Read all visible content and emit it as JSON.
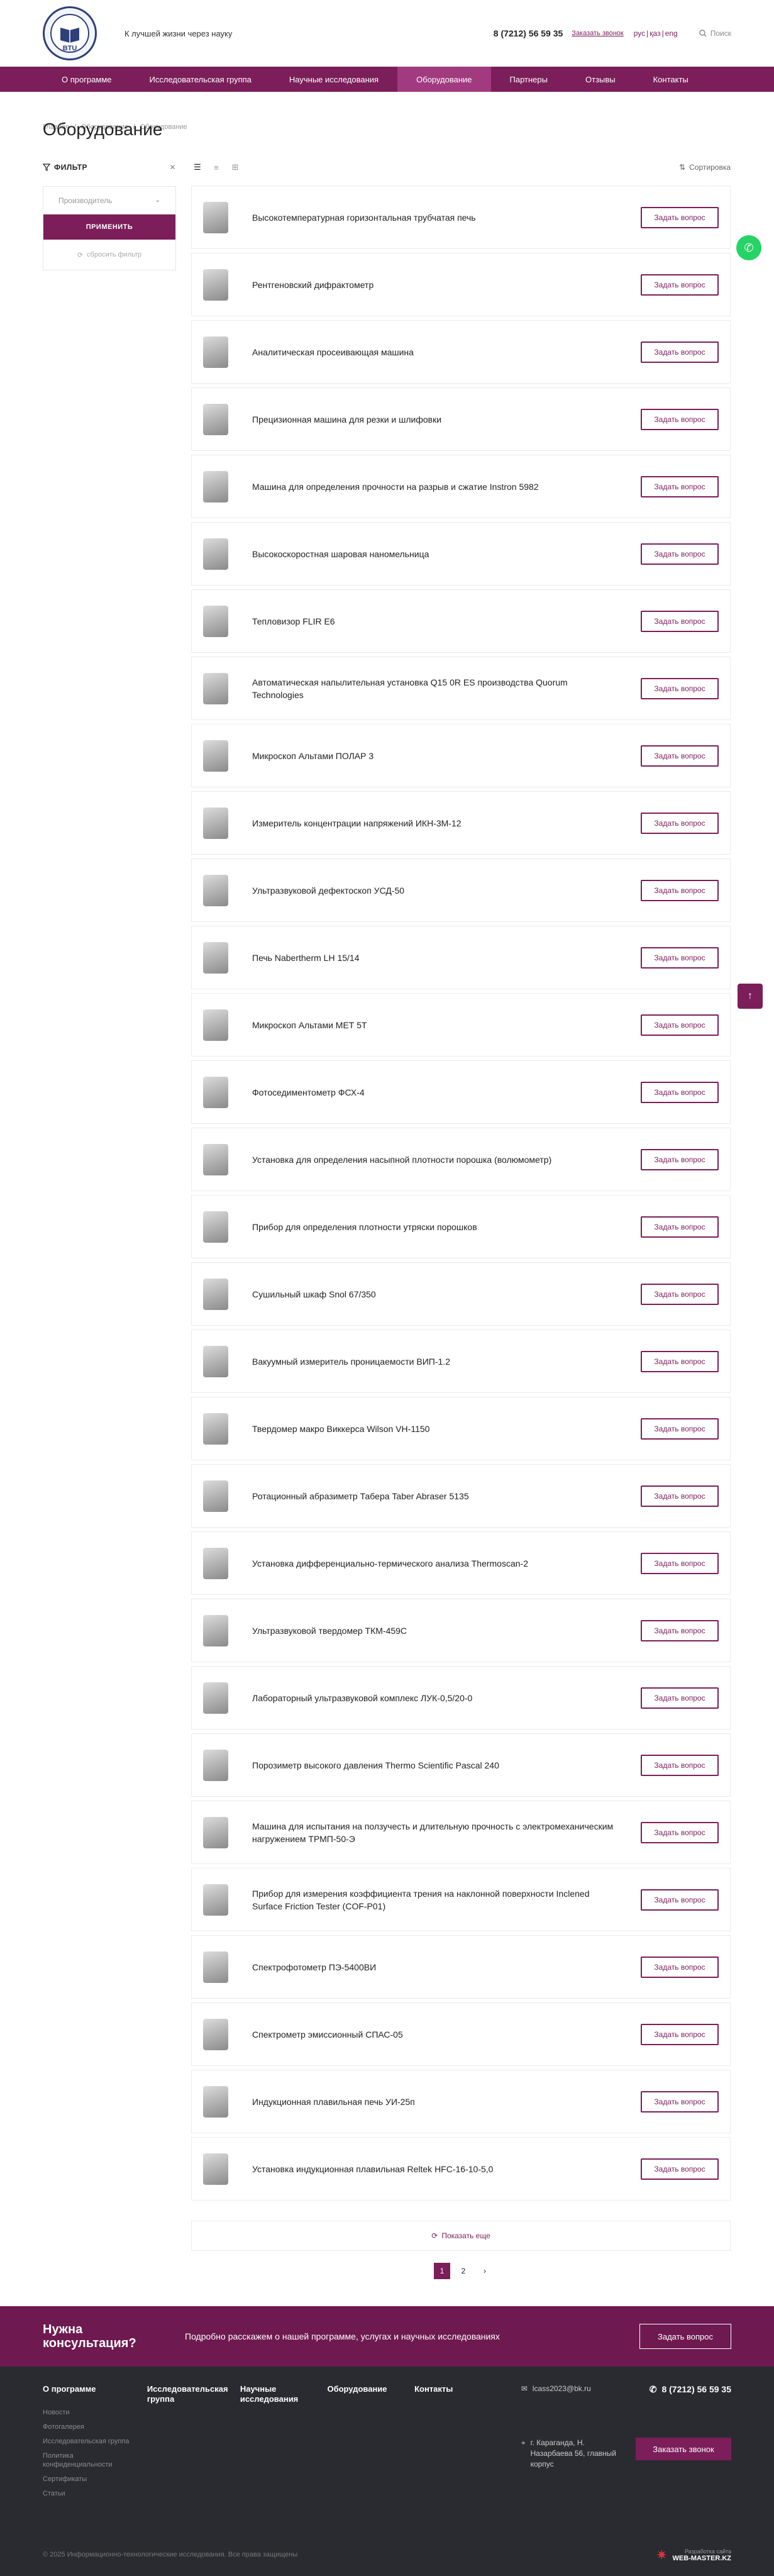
{
  "header": {
    "tagline": "К лучшей жизни через науку",
    "phone": "8 (7212) 56 59 35",
    "callback": "Заказать звонок",
    "langs": [
      "рус",
      "қаз",
      "eng"
    ],
    "search_label": "Поиск",
    "logo_text": "BTU"
  },
  "nav": [
    "О программе",
    "Исследовательская группа",
    "Научные исследования",
    "Оборудование",
    "Партнеры",
    "Отзывы",
    "Контакты"
  ],
  "nav_active_index": 3,
  "breadcrumb": [
    "Главная",
    "Оборудование",
    "Оборудование"
  ],
  "page_title": "Оборудование",
  "filter": {
    "title": "ФИЛЬТР",
    "select_placeholder": "Производитель",
    "apply_label": "ПРИМЕНИТЬ",
    "reset_label": "сбросить фильтр"
  },
  "toolbar": {
    "sort_label": "Сортировка"
  },
  "ask_label": "Задать вопрос",
  "items": [
    "Высокотемпературная горизонтальная трубчатая печь",
    "Рентгеновский дифрактометр",
    "Аналитическая просеивающая машина",
    "Прецизионная машина для резки и шлифовки",
    "Машина для определения прочности на разрыв и сжатие Instron 5982",
    "Высокоскоростная шаровая наномельница",
    "Тепловизор FLIR E6",
    "Автоматическая напылительная установка Q15 0R ES производства Quorum Technologies",
    "Микроскоп Альтами ПОЛАР 3",
    "Измеритель концентрации напряжений ИКН-3М-12",
    "Ультразвуковой дефектоскоп УСД-50",
    "Печь Nabertherm LH 15/14",
    "Микроскоп Альтами МЕТ 5Т",
    "Фотоседиментометр ФСХ-4",
    "Установка для определения насыпной плотности порошка (волюмометр)",
    "Прибор для определения плотности утряски порошков",
    "Сушильный шкаф Snol 67/350",
    "Вакуумный измеритель проницаемости ВИП-1.2",
    "Твердомер макро Виккерса Wilson VH-1150",
    "Ротационный абразиметр Табера Taber Abraser 5135",
    "Установка дифференциально-термического анализа Thermoscan-2",
    "Ультразвуковой твердомер ТКМ-459С",
    "Лабораторный ультразвуковой комплекс ЛУК-0,5/20-0",
    "Порозиметр высокого давления Thermo Scientific Pascal 240",
    "Машина для испытания на ползучесть и длительную прочность с электромеханическим нагружением ТРМП-50-Э",
    "Прибор для измерения коэффициента трения на наклонной поверхности Inclened Surface Friction Tester (COF-P01)",
    "Спектрофотометр ПЭ-5400ВИ",
    "Спектрометр эмиссионный СПАС-05",
    "Индукционная плавильная печь УИ-25п",
    "Установка индукционная плавильная Reltek HFC-16-10-5,0"
  ],
  "show_more": "Показать еще",
  "pagination": [
    "1",
    "2",
    "›"
  ],
  "consult": {
    "title": "Нужна консультация?",
    "text": "Подробно расскажем о нашей программе, услугах и научных исследованиях",
    "button": "Задать вопрос"
  },
  "footer": {
    "col1_title": "О программе",
    "col1_links": [
      "Новости",
      "Фотогалерея",
      "Исследовательская группа",
      "Политика конфиденциальности",
      "Сертификаты",
      "Статьи"
    ],
    "col2_title": "Исследовательская группа",
    "col3_title": "Научные исследования",
    "col4_title": "Оборудование",
    "col5_title": "Контакты",
    "email": "lcass2023@bk.ru",
    "phone": "8 (7212) 56 59 35",
    "address": "г. Караганда, Н. Назарбаева 56, главный корпус",
    "call_button": "Заказать звонок",
    "copyright": "© 2025 Информационно-технологические исследования. Все права защищены",
    "developer_label": "Разработка сайта",
    "developer_name": "WEB-MASTER.KZ"
  },
  "colors": {
    "brand": "#7b1e5a",
    "nav_active": "#a13a7f",
    "footer_bg": "#2a2b30",
    "whatsapp": "#25d366"
  }
}
